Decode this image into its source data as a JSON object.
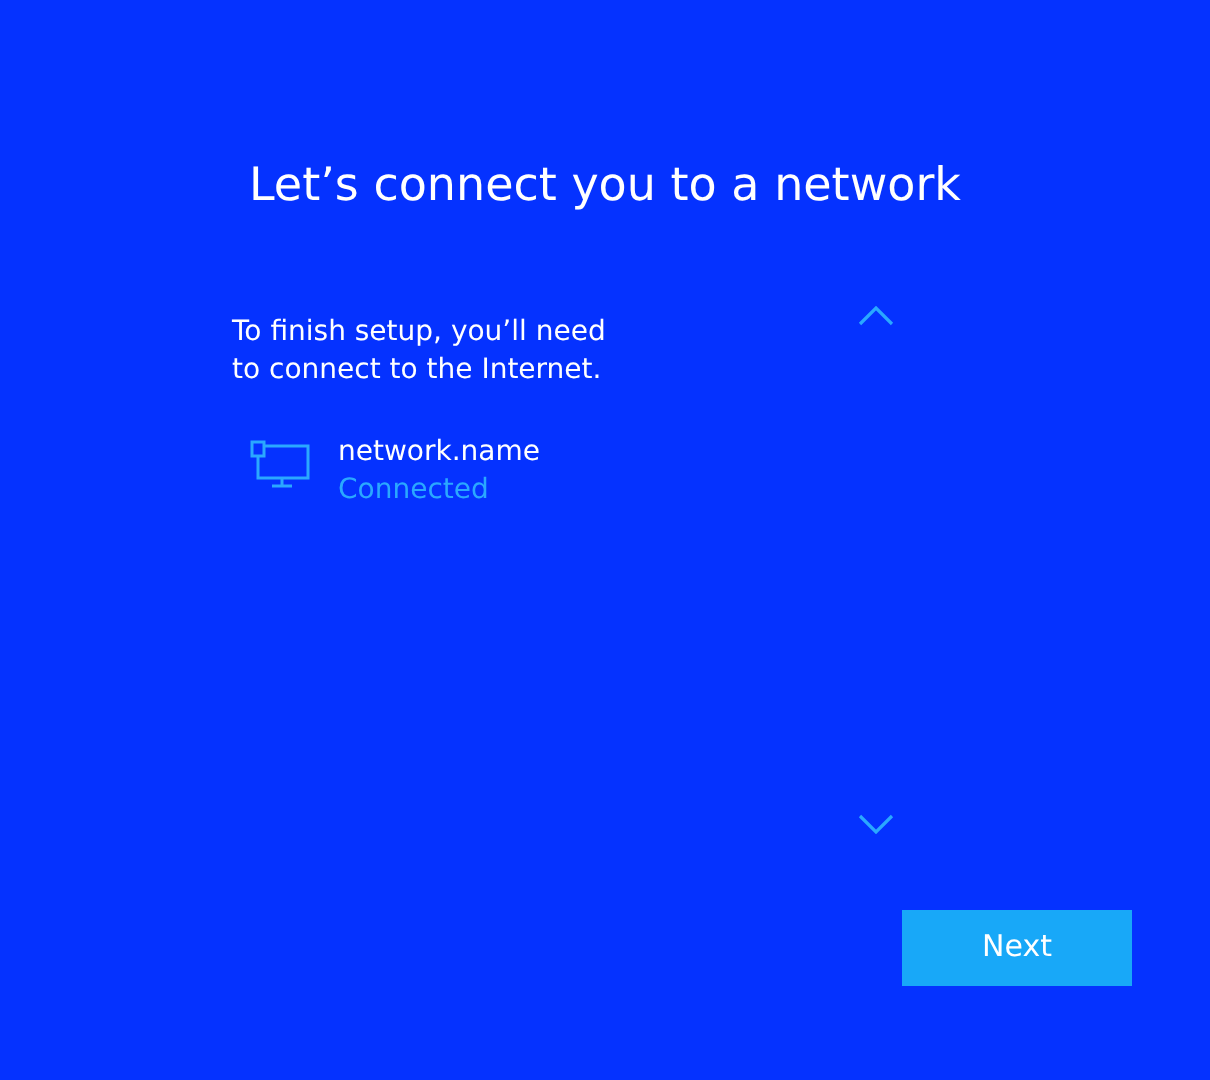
{
  "title": "Let’s connect you to a network",
  "description": "To finish setup, you’ll need to connect to the Internet.",
  "networks": [
    {
      "name": "network.name",
      "status": "Connected"
    }
  ],
  "buttons": [
    "Next"
  ]
}
